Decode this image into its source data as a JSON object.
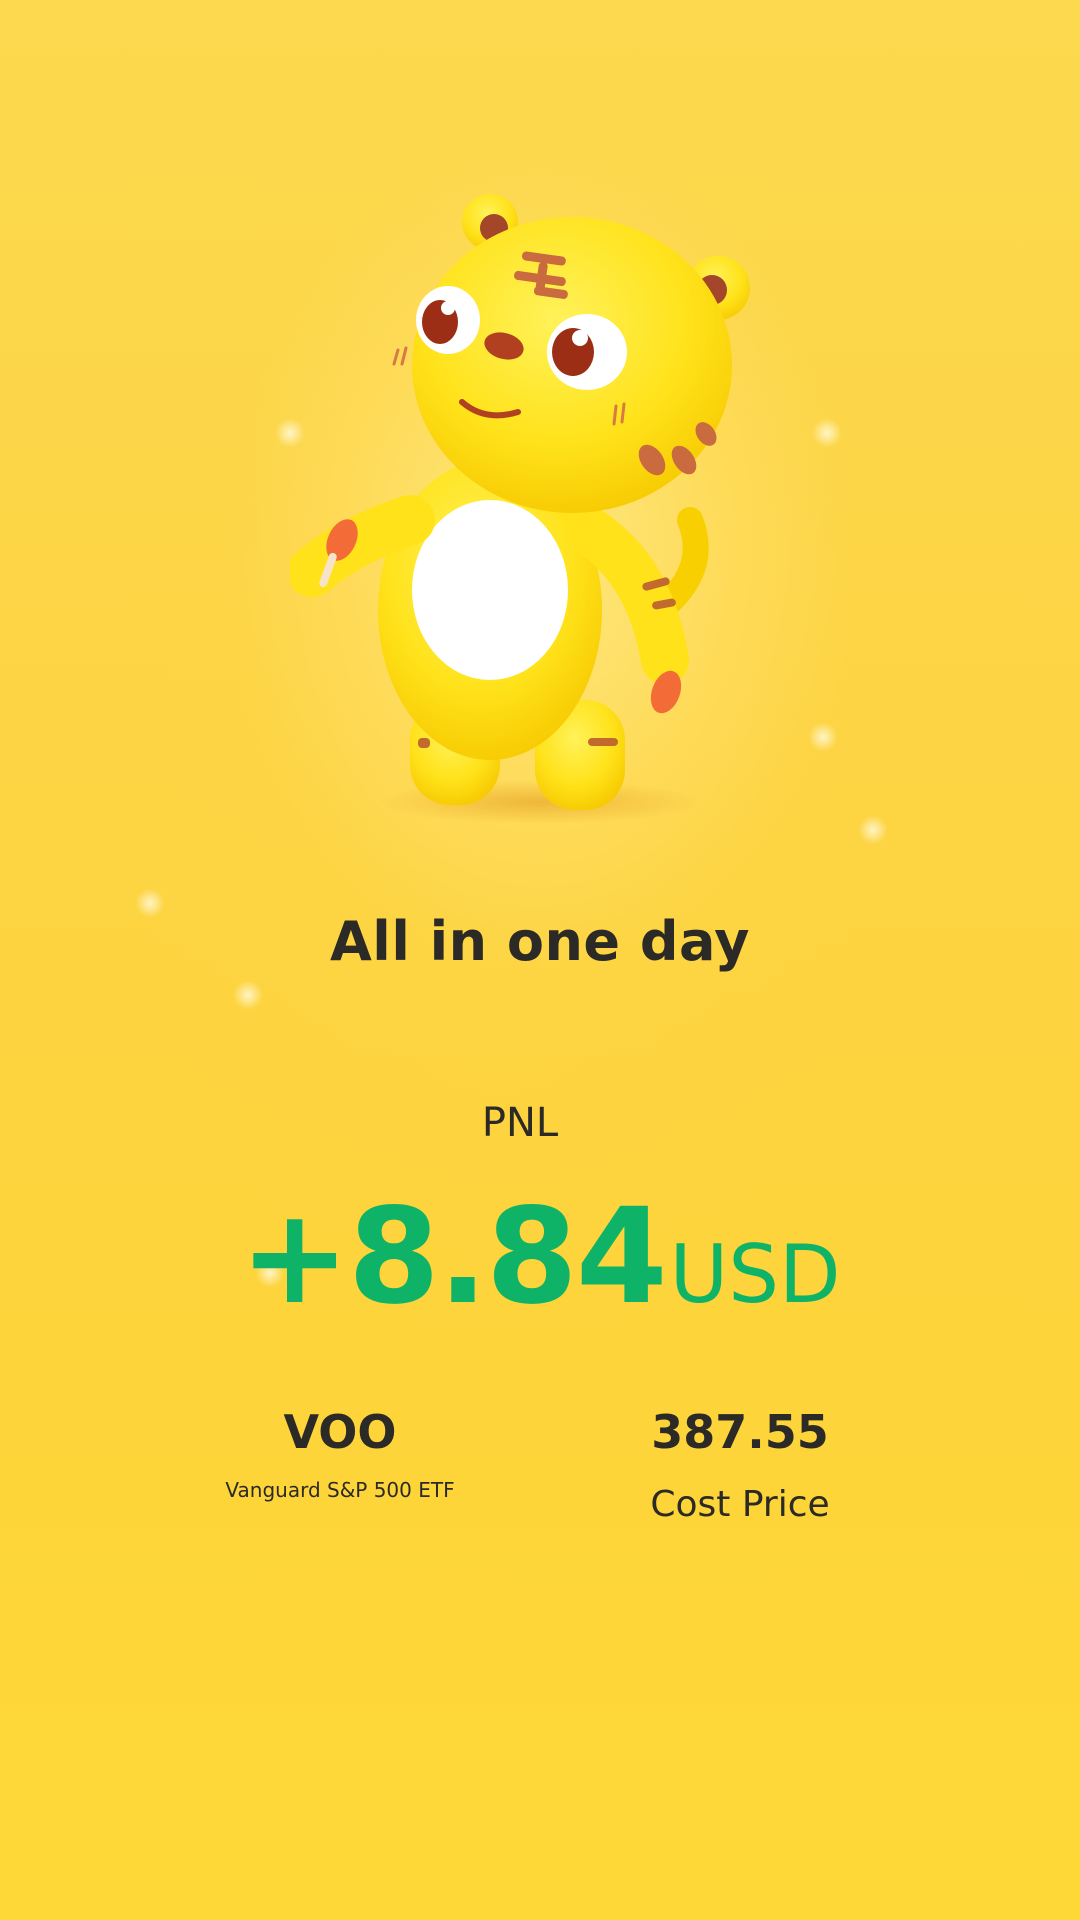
{
  "headline": "All in one day",
  "pnl": {
    "label": "PNL",
    "value": "+8.84",
    "currency": "USD",
    "color": "#0EB368"
  },
  "stock": {
    "ticker": "VOO",
    "name": "Vanguard S&P 500 ETF"
  },
  "cost": {
    "value": "387.55",
    "label": "Cost Price"
  },
  "mascot": {
    "icon": "tiger-mascot-icon"
  },
  "colors": {
    "background": "#FDD333",
    "text": "#2C2A26",
    "positive": "#0EB368"
  }
}
